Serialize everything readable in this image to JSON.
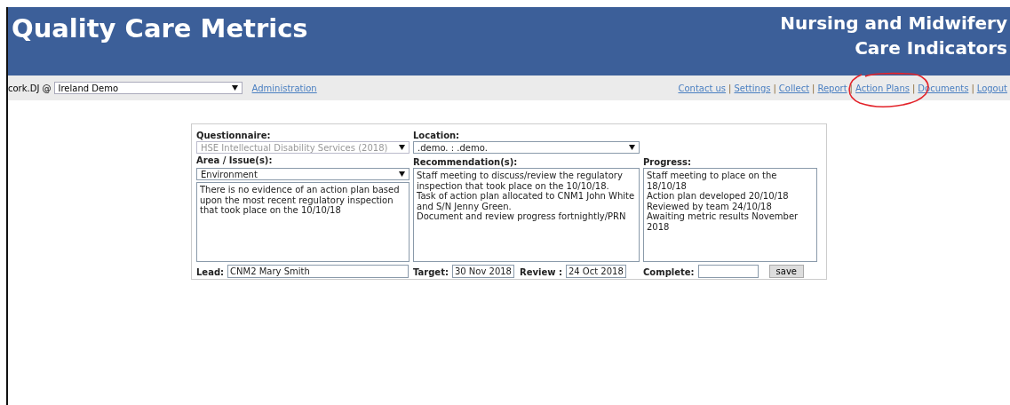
{
  "header": {
    "title": "Quality Care Metrics",
    "subtitle_lines": [
      "Nursing and Midwifery",
      "Care Indicators"
    ]
  },
  "toolbar": {
    "user": "cork.DJ @",
    "organisation": "Ireland Demo",
    "admin_link": "Administration",
    "separator": "|",
    "links": [
      "Contact us",
      "Settings",
      "Collect",
      "Report",
      "Action Plans",
      "Documents",
      "Logout"
    ]
  },
  "form": {
    "questionnaire": {
      "label": "Questionnaire:",
      "value": "HSE Intellectual Disability Services (2018)",
      "disabled": true
    },
    "location": {
      "label": "Location:",
      "value": ".demo. : .demo.",
      "disabled": false
    },
    "area": {
      "label": "Area / Issue(s):",
      "value": "Environment",
      "description": "There is no evidence of an action plan based upon the most recent regulatory inspection that took place on the 10/10/18"
    },
    "recommendations": {
      "label": "Recommendation(s):",
      "value": "Staff meeting to discuss/review the regulatory inspection that took place on the 10/10/18.\nTask of action plan allocated to CNM1 John White and S/N Jenny Green.\nDocument and review progress fortnightly/PRN"
    },
    "progress": {
      "label": "Progress:",
      "value": "Staff meeting to place on the 18/10/18\nAction plan developed 20/10/18\nReviewed by team 24/10/18\nAwaiting metric results November 2018"
    },
    "lead": {
      "label": "Lead:",
      "value": "CNM2 Mary Smith"
    },
    "target": {
      "label": "Target:",
      "value": "30 Nov 2018"
    },
    "review": {
      "label": "Review :",
      "value": "24 Oct 2018"
    },
    "complete": {
      "label": "Complete:"
    },
    "save_button": "save"
  }
}
